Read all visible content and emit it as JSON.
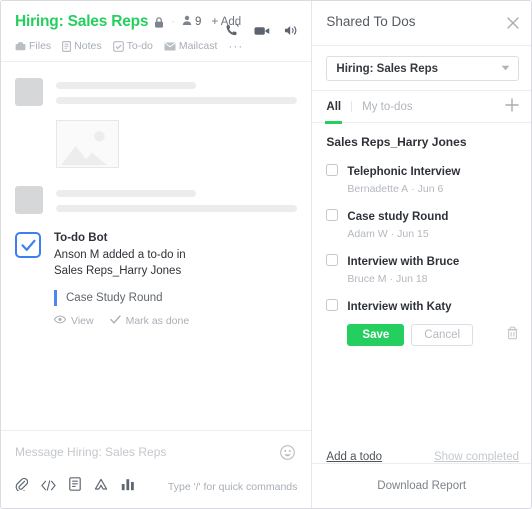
{
  "left": {
    "header": {
      "title": "Hiring: Sales Reps",
      "lock_icon": "lock-icon",
      "separator": "·",
      "member_icon": "person-icon",
      "member_count": "9",
      "add_label": "+ Add",
      "actions": [
        {
          "name": "call-icon",
          "label": "Call"
        },
        {
          "name": "video-icon",
          "label": "Video"
        },
        {
          "name": "speaker-icon",
          "label": "Speaker"
        }
      ],
      "subnav": [
        {
          "icon": "files-icon",
          "label": "Files"
        },
        {
          "icon": "notes-icon",
          "label": "Notes"
        },
        {
          "icon": "todo-icon",
          "label": "To-do"
        },
        {
          "icon": "mailcast-icon",
          "label": "Mailcast"
        }
      ],
      "subnav_more": "···"
    },
    "bot_message": {
      "icon": "checkbox-checked-icon",
      "name": "To-do Bot",
      "text_line1": "Anson M added a to-do in",
      "text_line2": "Sales Reps_Harry Jones",
      "quote": "Case Study Round",
      "actions": [
        {
          "icon": "eye-icon",
          "label": "View"
        },
        {
          "icon": "check-icon",
          "label": "Mark as done"
        }
      ]
    },
    "composer": {
      "placeholder": "Message Hiring: Sales Reps",
      "emoji_icon": "smiley-icon",
      "tools": [
        {
          "name": "attachment-icon"
        },
        {
          "name": "code-icon"
        },
        {
          "name": "document-icon"
        },
        {
          "name": "drive-icon"
        },
        {
          "name": "chart-icon"
        }
      ],
      "hint": "Type '/' for quick commands"
    }
  },
  "right": {
    "title": "Shared To Dos",
    "close_icon": "close-icon",
    "project_select": {
      "value": "Hiring: Sales Reps",
      "caret_icon": "chevron-down-icon"
    },
    "tabs": [
      {
        "label": "All",
        "active": true
      },
      {
        "label": "My to-dos",
        "active": false
      }
    ],
    "add_icon": "plus-icon",
    "group_title": "Sales Reps_Harry Jones",
    "todos": [
      {
        "label": "Telephonic Interview",
        "author": "Bernadette A",
        "date": "Jun 6",
        "editing": false
      },
      {
        "label": "Case study Round",
        "author": "Adam W",
        "date": "Jun 15",
        "editing": false
      },
      {
        "label": "Interview with Bruce",
        "author": "Bruce M",
        "date": "Jun 18",
        "editing": false
      },
      {
        "label": "Interview with Katy",
        "author": "",
        "date": "",
        "editing": true
      }
    ],
    "meta_dot": "·",
    "editing_actions": {
      "save_label": "Save",
      "cancel_label": "Cancel",
      "delete_icon": "trash-icon"
    },
    "footer": {
      "add_a_todo": "Add a todo",
      "show_completed": "Show completed"
    },
    "download_label": "Download Report"
  },
  "colors": {
    "brand_green": "#24cf5f",
    "accent_blue": "#3d7ff2",
    "text_dark": "#2e3238",
    "text_muted": "#b3b8be"
  }
}
